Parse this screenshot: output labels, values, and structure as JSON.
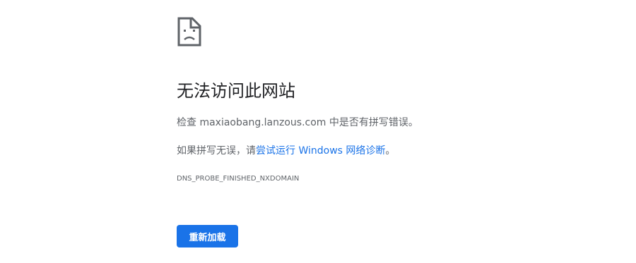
{
  "icon": {
    "name": "sad-page-icon"
  },
  "main": {
    "title": "无法访问此网站",
    "message_prefix": "检查 ",
    "domain": "maxiaobang.lanzous.com",
    "message_suffix": " 中是否有拼写错误。",
    "suggestion_prefix": "如果拼写无误，请",
    "diagnostics_link": "尝试运行 Windows 网络诊断",
    "suggestion_suffix": "。",
    "error_code": "DNS_PROBE_FINISHED_NXDOMAIN"
  },
  "buttons": {
    "reload": "重新加载"
  },
  "colors": {
    "accent": "#1a73e8",
    "title_text": "#202124",
    "body_text": "#5f6368",
    "icon_stroke": "#5f6368"
  }
}
